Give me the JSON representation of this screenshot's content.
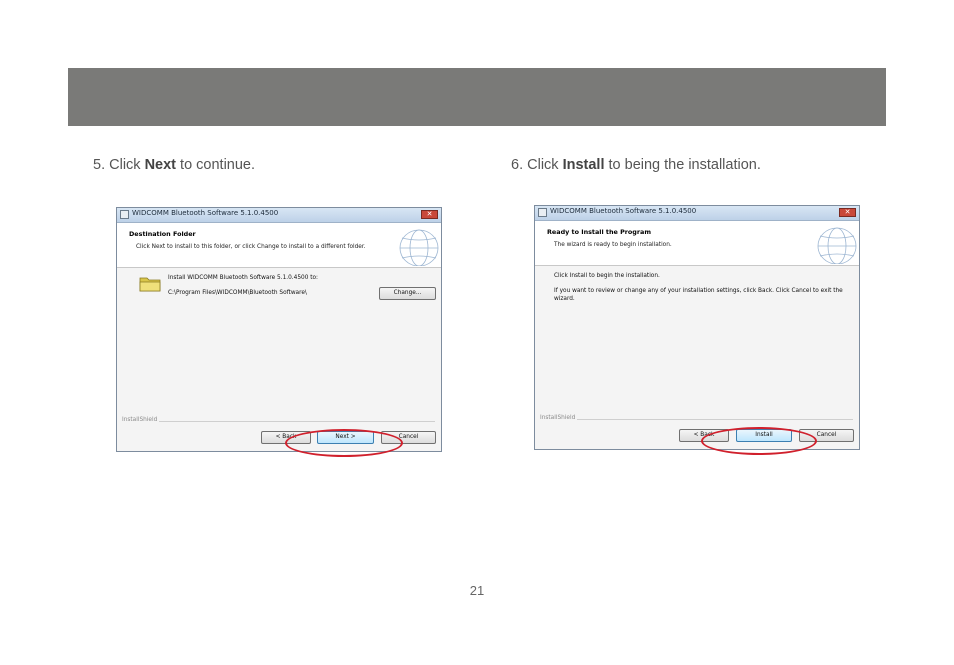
{
  "page_number": "21",
  "steps": [
    {
      "number": "5.",
      "prefix": "Click",
      "bold": "Next",
      "suffix": "to continue."
    },
    {
      "number": "6.",
      "prefix": "Click",
      "bold": "Install",
      "suffix": "to being the installation."
    }
  ],
  "dialog_left": {
    "window_title": "WIDCOMM Bluetooth Software 5.1.0.4500",
    "header_title": "Destination Folder",
    "header_subtitle": "Click Next to install to this folder, or click Change to install to a different folder.",
    "install_line": "Install WIDCOMM Bluetooth Software 5.1.0.4500 to:",
    "path": "C:\\Program Files\\WIDCOMM\\Bluetooth Software\\",
    "change_label": "Change...",
    "installshield": "InstallShield",
    "back_label": "< Back",
    "next_label": "Next >",
    "cancel_label": "Cancel"
  },
  "dialog_right": {
    "window_title": "WIDCOMM Bluetooth Software 5.1.0.4500",
    "header_title": "Ready to Install the Program",
    "header_subtitle": "The wizard is ready to begin installation.",
    "body_line1": "Click Install to begin the installation.",
    "body_line2": "If you want to review or change any of your installation settings, click Back. Click Cancel to exit the wizard.",
    "installshield": "InstallShield",
    "back_label": "< Back",
    "install_label": "Install",
    "cancel_label": "Cancel"
  },
  "colors": {
    "banner": "#7a7a78",
    "highlight_oval": "#d0202c",
    "close_button": "#c9483a"
  }
}
